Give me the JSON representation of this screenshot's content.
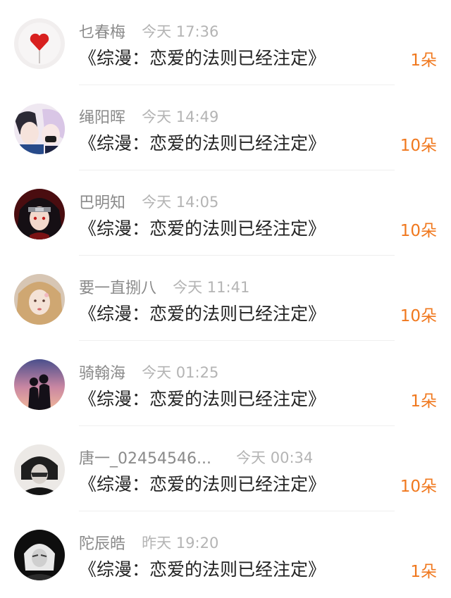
{
  "colors": {
    "name": "#8a8a8a",
    "time": "#b4b4b4",
    "title": "#222222",
    "count": "#f0781e",
    "divider": "#efefef"
  },
  "records": [
    {
      "name": "乜春梅",
      "time": "今天 17:36",
      "title": "《综漫：恋爱的法则已经注定》",
      "count": "1朵",
      "avatar_icon": "heart-avatar-icon"
    },
    {
      "name": "绳阳晖",
      "time": "今天 14:49",
      "title": "《综漫：恋爱的法则已经注定》",
      "count": "10朵",
      "avatar_icon": "anime-couple-avatar-icon"
    },
    {
      "name": "巴明知",
      "time": "今天 14:05",
      "title": "《综漫：恋爱的法则已经注定》",
      "count": "10朵",
      "avatar_icon": "ninja-avatar-icon"
    },
    {
      "name": "要一直捌八",
      "time": "今天 11:41",
      "title": "《综漫：恋爱的法则已经注定》",
      "count": "10朵",
      "avatar_icon": "blonde-girl-avatar-icon"
    },
    {
      "name": "骑翰海",
      "time": "今天 01:25",
      "title": "《综漫：恋爱的法则已经注定》",
      "count": "1朵",
      "avatar_icon": "sunset-couple-avatar-icon"
    },
    {
      "name": "唐一_02454546...",
      "time": "今天 00:34",
      "title": "《综漫：恋爱的法则已经注定》",
      "count": "10朵",
      "avatar_icon": "dark-portrait-avatar-icon"
    },
    {
      "name": "陀辰皓",
      "time": "昨天 19:20",
      "title": "《综漫：恋爱的法则已经注定》",
      "count": "1朵",
      "avatar_icon": "white-hair-avatar-icon"
    }
  ]
}
